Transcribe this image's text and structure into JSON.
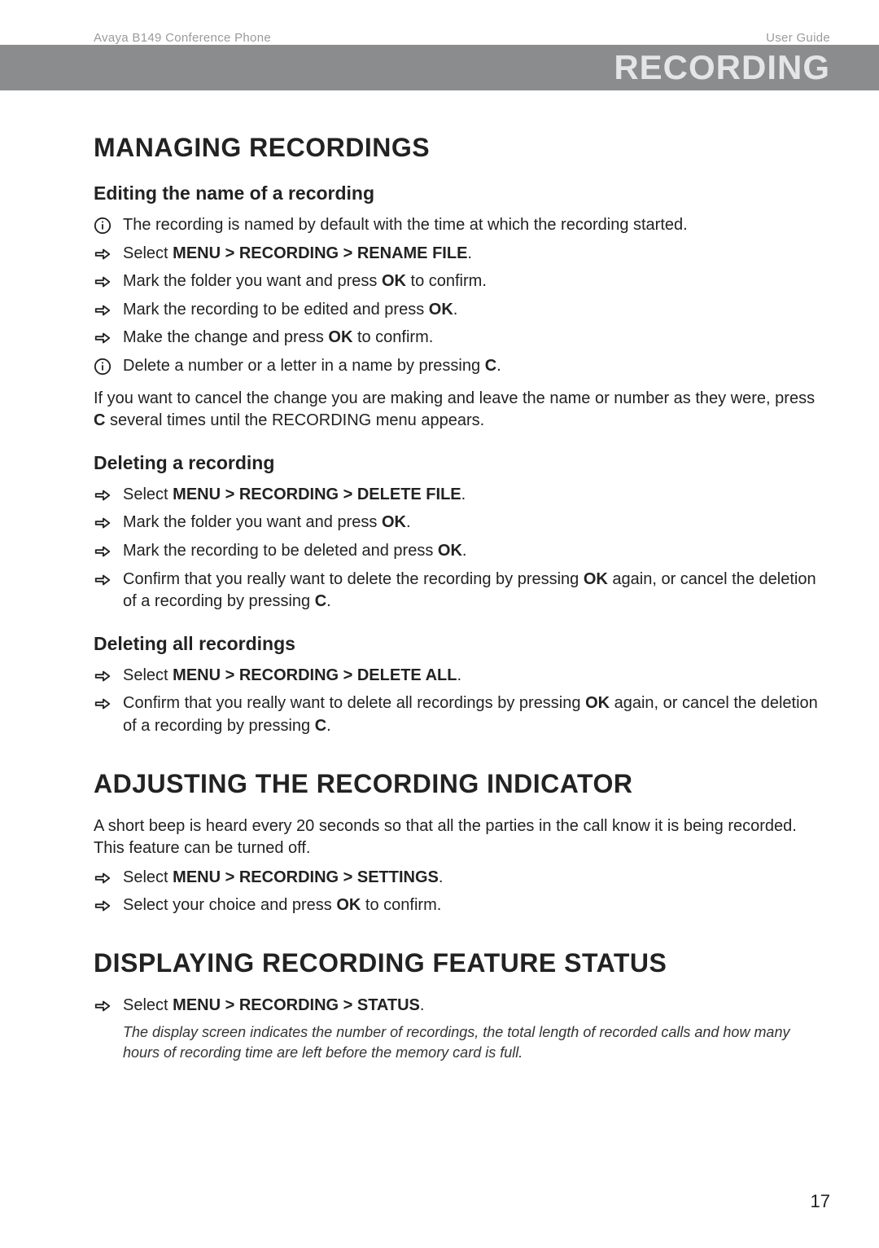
{
  "meta": {
    "doc_left": "Avaya B149 Conference Phone",
    "doc_right": "User Guide",
    "banner": "RECORDING",
    "pagenum": "17"
  },
  "s1": {
    "h": "MANAGING RECORDINGS",
    "sub1": {
      "h": "Editing the name of a recording",
      "i1": "The recording is named by default with the time at which the recording started.",
      "a1_pre": "Select ",
      "a1_path": "MENU > RECORDING > RENAME FILE",
      "a2_pre": "Mark the folder you want and press ",
      "a2_b": "OK",
      "a2_post": " to confirm.",
      "a3_pre": "Mark the recording to be edited and press ",
      "a3_b": "OK",
      "a3_post": ".",
      "a4_pre": "Make the change and press ",
      "a4_b": "OK",
      "a4_post": " to confirm.",
      "i2_pre": "Delete a number or a letter in a name by pressing ",
      "i2_b": "C",
      "i2_post": ".",
      "p1_pre": "If you want to cancel the change you are making and leave the name or number as they were, press ",
      "p1_b": "C",
      "p1_post": " several times until the RECORDING menu appears."
    },
    "sub2": {
      "h": "Deleting a recording",
      "a1_pre": "Select ",
      "a1_path": "MENU > RECORDING > DELETE FILE",
      "a2_pre": "Mark the folder you want and press ",
      "a2_b": "OK",
      "a2_post": ".",
      "a3_pre": "Mark the recording to be deleted and press ",
      "a3_b": "OK",
      "a3_post": ".",
      "a4_pre": "Confirm that you really want to delete the recording by pressing ",
      "a4_b": "OK",
      "a4_mid": " again, or cancel the deletion of a recording by pressing ",
      "a4_b2": "C",
      "a4_post": "."
    },
    "sub3": {
      "h": "Deleting all recordings",
      "a1_pre": "Select ",
      "a1_path": "MENU > RECORDING > DELETE ALL",
      "a2_pre": "Confirm that you really want to delete all recordings by pressing ",
      "a2_b": "OK",
      "a2_mid": " again, or cancel the deletion of a recording by pressing ",
      "a2_b2": "C",
      "a2_post": "."
    }
  },
  "s2": {
    "h": "ADJUSTING THE RECORDING INDICATOR",
    "p": "A short beep is heard every 20 seconds so that all the parties in the call know it is being recorded. This feature can be turned off.",
    "a1_pre": "Select ",
    "a1_path": "MENU > RECORDING > SETTINGS",
    "a2_pre": "Select your choice and press ",
    "a2_b": "OK",
    "a2_post": " to confirm."
  },
  "s3": {
    "h": "DISPLAYING RECORDING FEATURE STATUS",
    "a1_pre": "Select ",
    "a1_path": "MENU > RECORDING > STATUS",
    "note": "The display screen indicates the number of recordings, the total length of recorded calls and how many hours of recording time are left before the memory card is full."
  }
}
